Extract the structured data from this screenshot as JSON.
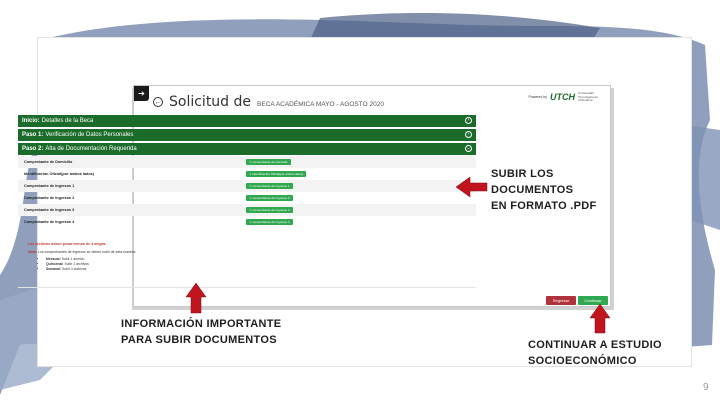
{
  "app": {
    "menu_glyph": "➔",
    "title": "Solicitud de",
    "subtitle": "BECA ACADÉMICA MAYO - AGOSTO 2020",
    "brand_small": "Powered by",
    "brand_logo": "UTCH",
    "brand_caption": "Universidad Tecnológica de Chihuahua"
  },
  "sections": [
    {
      "step": "Inicio:",
      "label": "Detalles de la Beca",
      "caret": "›"
    },
    {
      "step": "Paso 1:",
      "label": "Verificación de Datos Personales",
      "caret": "›"
    },
    {
      "step": "Paso 2:",
      "label": "Alta de Documentación Requerida",
      "caret": "⌄"
    }
  ],
  "documents": [
    {
      "label": "Comprobante de Domicilio",
      "button": "⇩ Comprobante de Domicilio"
    },
    {
      "label": "Identificación Oficial(por ambos lados)",
      "button": "⇩ Identificación Oficial(por ambos lados)"
    },
    {
      "label": "Comprobante de Ingresos 1",
      "button": "⇩ Comprobante de Ingresos 1"
    },
    {
      "label": "Comprobante de Ingresos 2",
      "button": "⇩ Comprobante de Ingresos 2"
    },
    {
      "label": "Comprobante de Ingresos 3",
      "button": "⇩ Comprobante de Ingresos 3"
    },
    {
      "label": "Comprobante de Ingresos 4",
      "button": "⇩ Comprobante de Ingresos 4"
    }
  ],
  "notes": {
    "warning": "Los archivos deben pesar menos de 4 megas.",
    "note_label": "Nota:",
    "note_text": "Los comprobantes de ingresos se deben subir de esta manera.",
    "items": [
      {
        "label": "Mensual:",
        "text": "Subir 1 archivo"
      },
      {
        "label": "Quincenal:",
        "text": "Subir 2 archivos"
      },
      {
        "label": "Semanal:",
        "text": "Subir 4 archivos"
      }
    ]
  },
  "buttons": {
    "back": "Regresar",
    "continue": "Continuar"
  },
  "callouts": {
    "upload": [
      "SUBIR LOS",
      "DOCUMENTOS",
      "EN FORMATO .PDF"
    ],
    "info": [
      "INFORMACIÓN IMPORTANTE",
      "PARA SUBIR DOCUMENTOS"
    ],
    "continue": [
      "CONTINUAR A ESTUDIO",
      "SOCIOECONÓMICO"
    ]
  },
  "page_number": "9",
  "colors": {
    "header_green": "#1b6b2a",
    "button_green": "#2fa84f",
    "back_red": "#b0323a",
    "arrow_red": "#c0141e",
    "brush_blue": "#6a7fa6"
  }
}
